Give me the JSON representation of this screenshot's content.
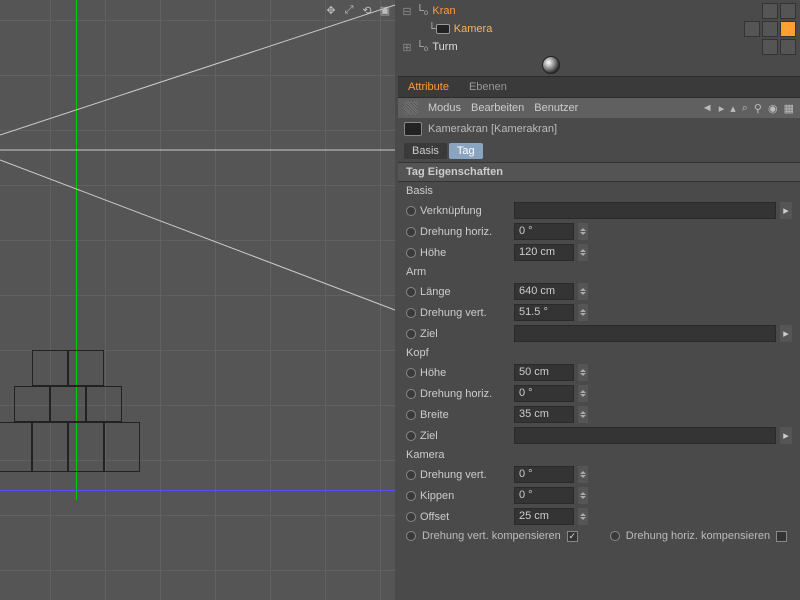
{
  "viewport": {
    "icons": [
      "move",
      "rotate",
      "scale",
      "fit"
    ]
  },
  "om": {
    "items": [
      {
        "name": "Kran",
        "expanded": true,
        "sel": true,
        "children": [
          {
            "name": "Kamera",
            "sel": true
          }
        ]
      },
      {
        "name": "Turm",
        "expanded": false,
        "sel": false
      }
    ]
  },
  "attr": {
    "tabs": [
      {
        "label": "Attribute",
        "active": true
      },
      {
        "label": "Ebenen",
        "active": false
      }
    ],
    "modebar": {
      "modus": "Modus",
      "bearbeiten": "Bearbeiten",
      "benutzer": "Benutzer"
    },
    "object_line": "Kamerakran [Kamerakran]",
    "subtabs": [
      {
        "label": "Basis",
        "active": false
      },
      {
        "label": "Tag",
        "active": true
      }
    ],
    "section_title": "Tag Eigenschaften",
    "groups": [
      {
        "title": "Basis",
        "rows": [
          {
            "label": "Verknüpfung",
            "type": "link"
          },
          {
            "label": "Drehung horiz.",
            "value": "0 °",
            "type": "num"
          },
          {
            "label": "Höhe",
            "value": "120 cm",
            "type": "num"
          }
        ]
      },
      {
        "title": "Arm",
        "rows": [
          {
            "label": "Länge",
            "value": "640 cm",
            "type": "num"
          },
          {
            "label": "Drehung vert.",
            "value": "51.5 °",
            "type": "num"
          },
          {
            "label": "Ziel",
            "type": "link"
          }
        ]
      },
      {
        "title": "Kopf",
        "rows": [
          {
            "label": "Höhe",
            "value": "50 cm",
            "type": "num"
          },
          {
            "label": "Drehung horiz.",
            "value": "0 °",
            "type": "num"
          },
          {
            "label": "Breite",
            "value": "35 cm",
            "type": "num"
          },
          {
            "label": "Ziel",
            "type": "link"
          }
        ]
      },
      {
        "title": "Kamera",
        "rows": [
          {
            "label": "Drehung vert.",
            "value": "0 °",
            "type": "num"
          },
          {
            "label": "Kippen",
            "value": "0 °",
            "type": "num"
          },
          {
            "label": "Offset",
            "value": "25 cm",
            "type": "num"
          }
        ]
      }
    ],
    "checks": [
      {
        "label": "Drehung vert. kompensieren",
        "checked": true
      },
      {
        "label": "Drehung horiz. kompensieren",
        "checked": false
      }
    ]
  }
}
